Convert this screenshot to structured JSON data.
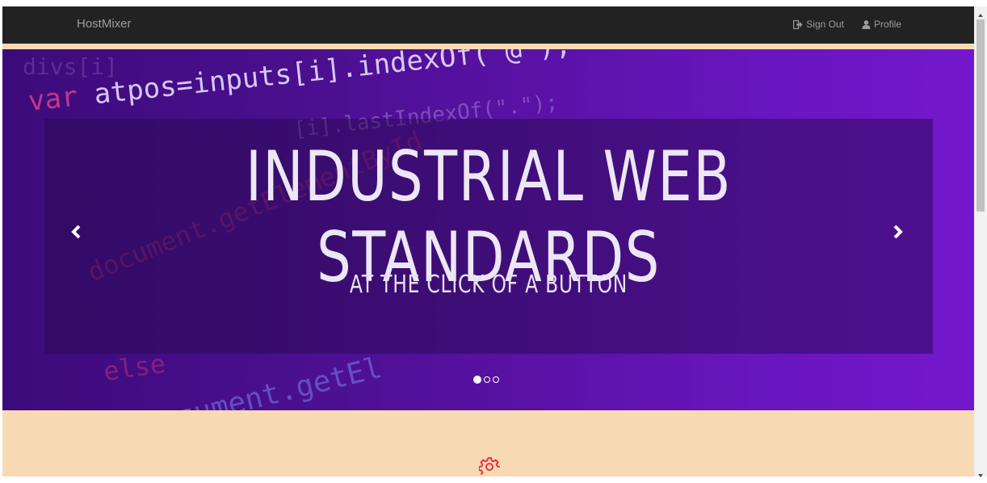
{
  "navbar": {
    "brand": "HostMixer",
    "links": [
      {
        "label": "Sign Out",
        "icon": "sign-out-icon"
      },
      {
        "label": "Profile",
        "icon": "user-icon"
      }
    ]
  },
  "carousel": {
    "headline": "INDUSTRIAL WEB STANDARDS",
    "subline": "AT THE CLICK OF A BUTTON",
    "slide_count": 3,
    "active_slide": 1,
    "background_code": {
      "line1_kw": "var",
      "line1": "atpos=inputs[i].indexOf(\"@\");",
      "line2": "[i].lastIndexOf(\".\");",
      "line3": "document.getElementById",
      "line4": "else",
      "line5": "document.getEl",
      "line6": "divs[i]"
    }
  },
  "colors": {
    "navbar_bg": "#222222",
    "accent_peach": "#f7dab3",
    "carousel_purple": "#6a16c0",
    "gear_red": "#e8304a"
  }
}
